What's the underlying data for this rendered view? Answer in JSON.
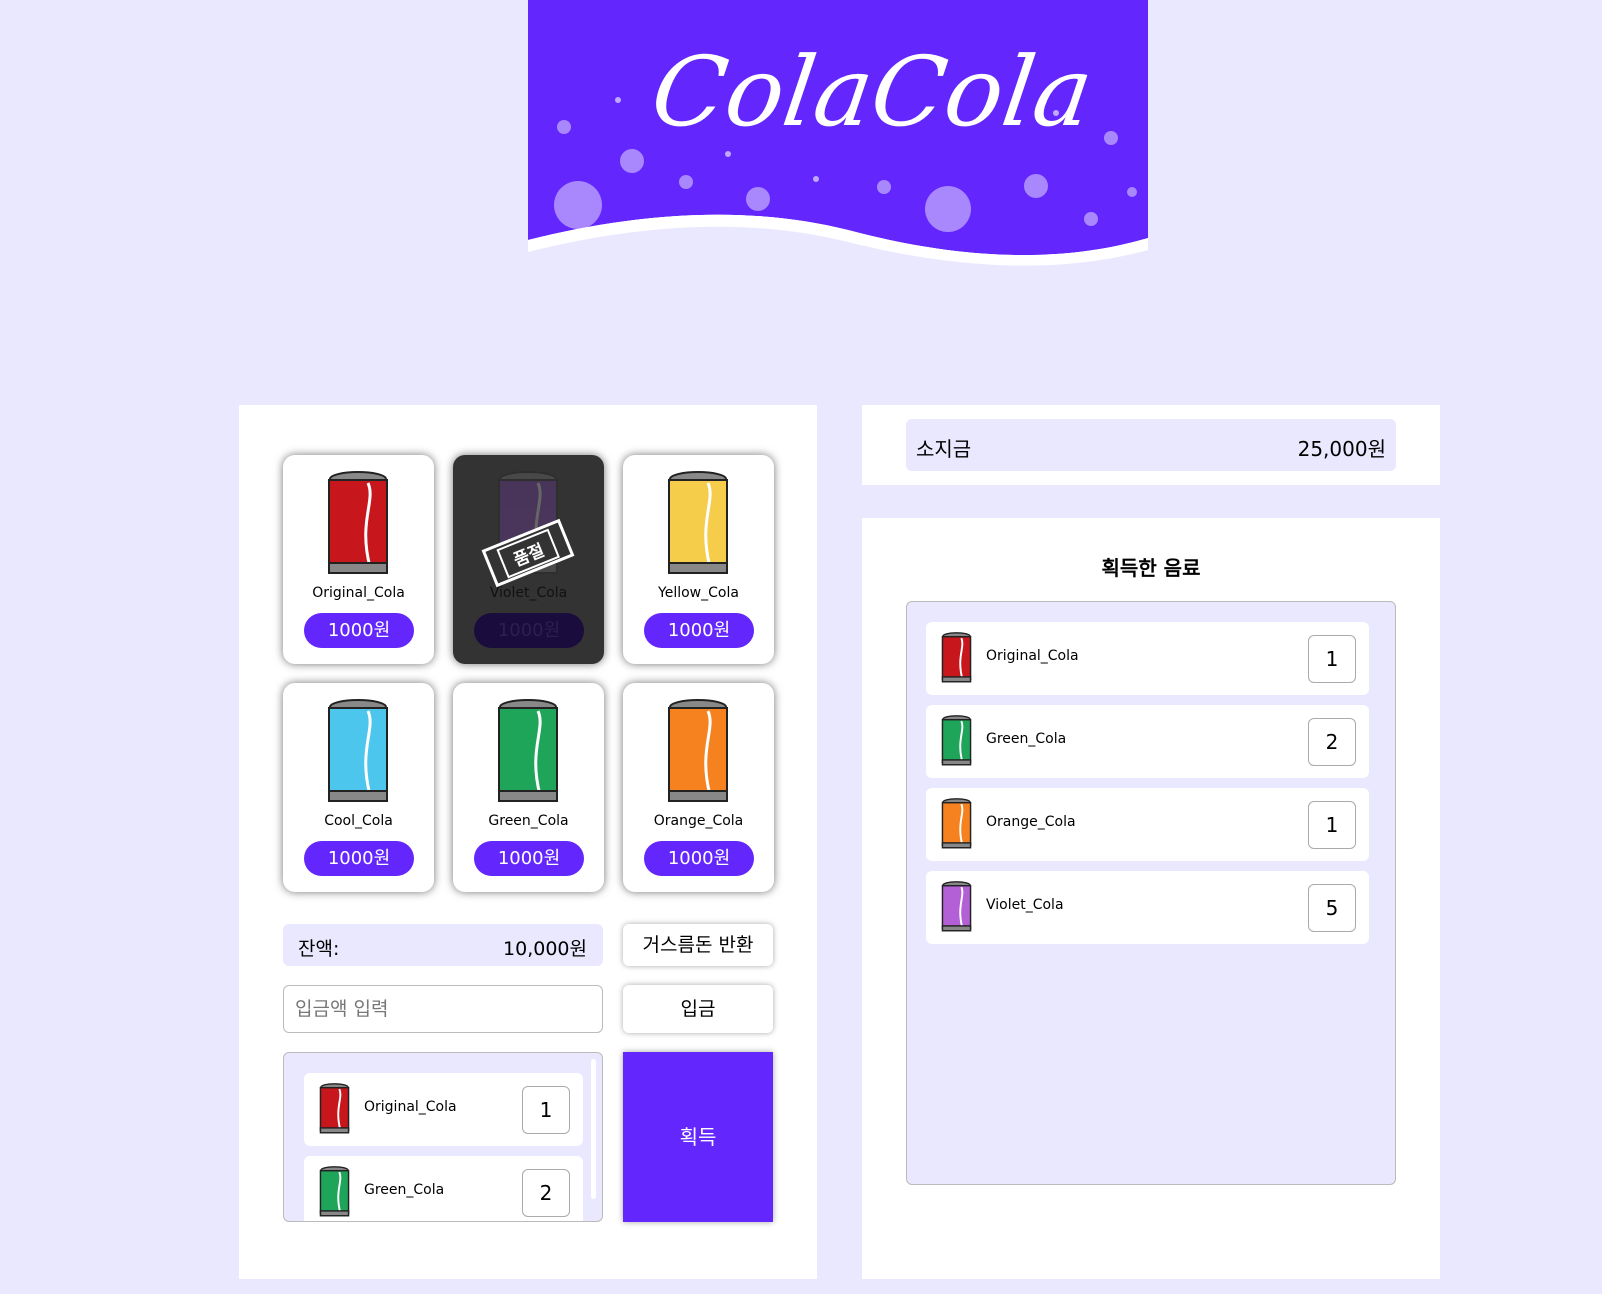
{
  "banner": {
    "logo_text": "ColaCola",
    "color": "#6327fe"
  },
  "colors": {
    "accent": "#6327fe",
    "background": "#eae8fe"
  },
  "products": [
    {
      "name": "Original_Cola",
      "price": "1000원",
      "can_color": "#c8161d",
      "soldout": false
    },
    {
      "name": "Violet_Cola",
      "price": "1000원",
      "can_color": "#8b3fd0",
      "soldout": true
    },
    {
      "name": "Yellow_Cola",
      "price": "1000원",
      "can_color": "#f5cd4a",
      "soldout": false
    },
    {
      "name": "Cool_Cola",
      "price": "1000원",
      "can_color": "#4dc6ee",
      "soldout": false
    },
    {
      "name": "Green_Cola",
      "price": "1000원",
      "can_color": "#1fa55a",
      "soldout": false
    },
    {
      "name": "Orange_Cola",
      "price": "1000원",
      "can_color": "#f5821f",
      "soldout": false
    }
  ],
  "soldout_label": "품절",
  "balance": {
    "label": "잔액:",
    "value": "10,000원"
  },
  "change_button": "거스름돈 반환",
  "deposit": {
    "placeholder": "입금액 입력",
    "button": "입금"
  },
  "cart": {
    "items": [
      {
        "name": "Original_Cola",
        "qty": "1",
        "can_color": "#c8161d"
      },
      {
        "name": "Green_Cola",
        "qty": "2",
        "can_color": "#1fa55a"
      }
    ]
  },
  "acquire_button": "획득",
  "wallet": {
    "label": "소지금",
    "value": "25,000원"
  },
  "acquired": {
    "title": "획득한 음료",
    "items": [
      {
        "name": "Original_Cola",
        "qty": "1",
        "can_color": "#c8161d"
      },
      {
        "name": "Green_Cola",
        "qty": "2",
        "can_color": "#1fa55a"
      },
      {
        "name": "Orange_Cola",
        "qty": "1",
        "can_color": "#f5821f"
      },
      {
        "name": "Violet_Cola",
        "qty": "5",
        "can_color": "#b35fd6"
      }
    ]
  }
}
